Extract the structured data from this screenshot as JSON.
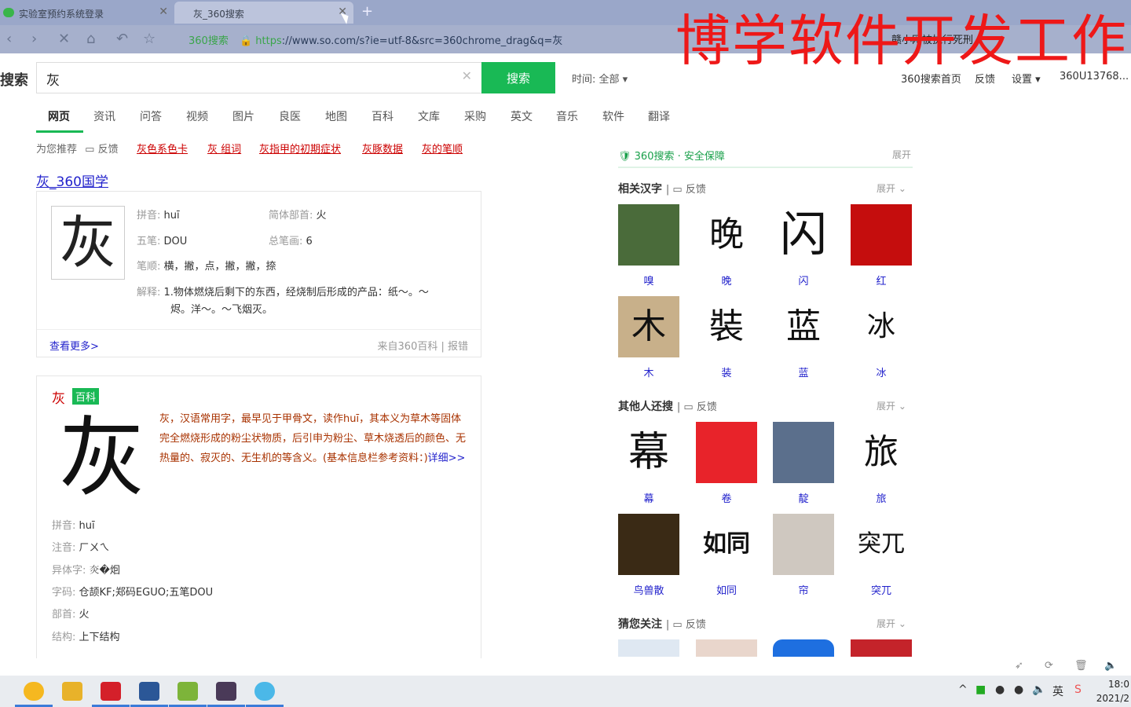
{
  "browser": {
    "tabs": [
      {
        "label": "实验室预约系统登录"
      },
      {
        "label": "灰_360搜索"
      }
    ],
    "url_prefix": "360搜索",
    "url_scheme": "https",
    "url_rest": "://www.so.com/s?ie=utf-8&src=360chrome_drag&q=灰",
    "bookmark_text": "赣小网被执行死刑"
  },
  "watermark": "博学软件开发工作",
  "search": {
    "logo": "搜索",
    "query": "灰",
    "button": "搜索",
    "time_filter": "时间: 全部 ▾",
    "links": [
      "360搜索首页",
      "反馈",
      "设置 ▾",
      "360U13768..."
    ]
  },
  "vertical_tabs": [
    "网页",
    "资讯",
    "问答",
    "视频",
    "图片",
    "良医",
    "地图",
    "百科",
    "文库",
    "采购",
    "英文",
    "音乐",
    "软件",
    "翻译"
  ],
  "recommend": {
    "label": "为您推荐",
    "feedback": "反馈",
    "items": [
      "灰色系色卡",
      "灰 组词",
      "灰指甲的初期症状",
      "灰豚数据",
      "灰的笔顺"
    ]
  },
  "result1": {
    "title": "灰_360国学",
    "char": "灰",
    "pinyin_label": "拼音:",
    "pinyin": "huī",
    "radical_label": "简体部首:",
    "radical": "火",
    "wubi_label": "五笔:",
    "wubi": "DOU",
    "strokes_label": "总笔画:",
    "strokes": "6",
    "order_label": "笔顺:",
    "order": "横，撇，点，撇，撇，捺",
    "def_label": "解释:",
    "def_line1": "1.物体燃烧后剩下的东西，经烧制后形成的产品：纸～。～",
    "def_line2": "烬。洋～。～飞烟灭。",
    "more": "查看更多>",
    "source": "来自360百科 | 报错"
  },
  "result2": {
    "title": "灰",
    "badge": "百科",
    "char": "灰",
    "desc": "灰，汉语常用字，最早见于甲骨文，读作huī，其本义为草木等固体完全燃烧形成的粉尘状物质，后引申为粉尘、草木烧透后的颜色、无热量的、寂灭的、无生机的等含义。(基本信息栏参考资料：)",
    "detail": "详细>>",
    "rows": [
      {
        "label": "拼音:",
        "value": "huī"
      },
      {
        "label": "注音:",
        "value": "ㄏㄨㄟ"
      },
      {
        "label": "异体字:",
        "value": "𤆍�𤇆"
      },
      {
        "label": "字码:",
        "value": "仓颉KF;郑码EGUO;五笔DOU"
      },
      {
        "label": "部首:",
        "value": "火"
      },
      {
        "label": "结构:",
        "value": "上下结构"
      }
    ]
  },
  "sidebar": {
    "safe": "360搜索 · 安全保障",
    "expand": "展开",
    "sections": [
      {
        "title": "相关汉字",
        "feedback": "反馈",
        "items": [
          {
            "glyph": "",
            "cap": "嗅"
          },
          {
            "glyph": "晚",
            "cap": "晚"
          },
          {
            "glyph": "闪",
            "cap": "闪"
          },
          {
            "glyph": "",
            "cap": "红"
          },
          {
            "glyph": "木",
            "cap": "木"
          },
          {
            "glyph": "裝",
            "cap": "装"
          },
          {
            "glyph": "蓝",
            "cap": "蓝"
          },
          {
            "glyph": "冰",
            "cap": "冰"
          }
        ]
      },
      {
        "title": "其他人还搜",
        "feedback": "反馈",
        "items": [
          {
            "glyph": "幕",
            "cap": "幕"
          },
          {
            "glyph": "",
            "cap": "卷"
          },
          {
            "glyph": "",
            "cap": "靛"
          },
          {
            "glyph": "旅",
            "cap": "旅"
          },
          {
            "glyph": "",
            "cap": "鸟兽散"
          },
          {
            "glyph": "如同",
            "cap": "如同"
          },
          {
            "glyph": "",
            "cap": "帘"
          },
          {
            "glyph": "突兀",
            "cap": "突兀"
          }
        ]
      },
      {
        "title": "猜您关注",
        "feedback": "反馈"
      }
    ]
  },
  "taskbar": {
    "time": "18:0",
    "date": "2021/2"
  },
  "colors": {
    "accent": "#19b955",
    "link": "#2222cc",
    "red": "#cc0000"
  }
}
